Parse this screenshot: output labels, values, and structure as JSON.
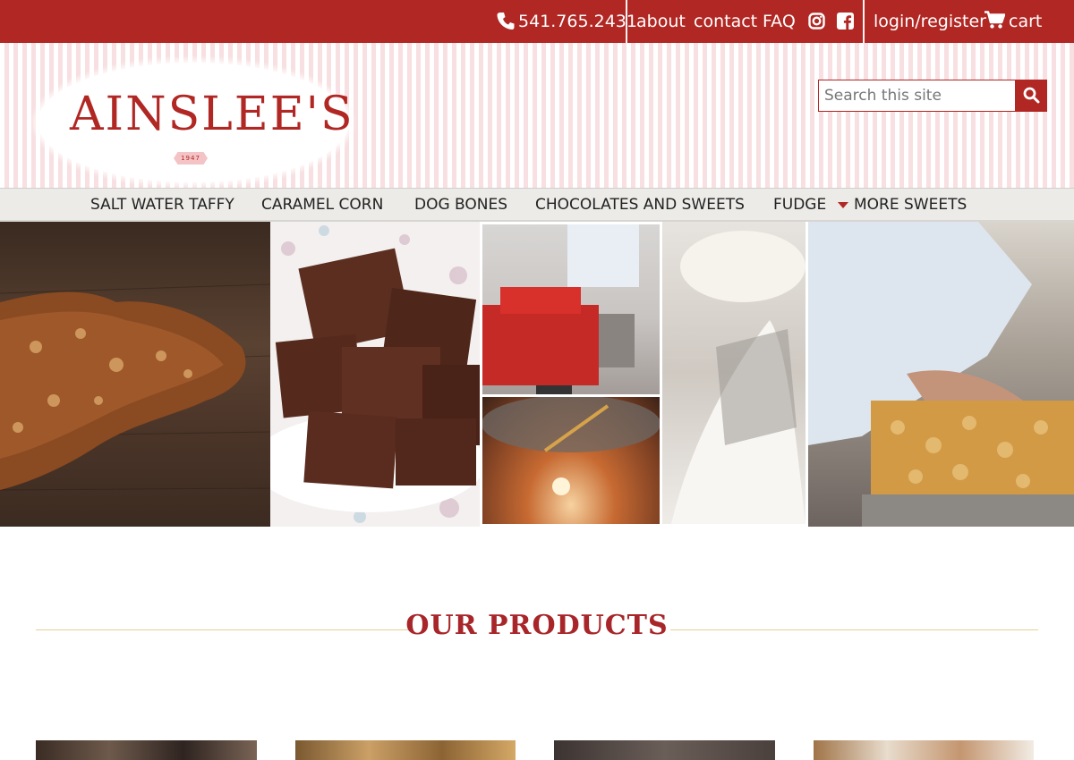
{
  "topbar": {
    "phone": "541.765.2431",
    "links": [
      "about",
      "contact",
      "FAQ"
    ],
    "login": "login/register",
    "cart": "cart",
    "icons": [
      "phone-icon",
      "instagram-icon",
      "facebook-icon",
      "cart-icon"
    ]
  },
  "header": {
    "logo_text": "AINSLEE'S",
    "logo_year": "1947",
    "search_placeholder": "Search this site"
  },
  "nav": {
    "items": [
      "SALT WATER TAFFY",
      "CARAMEL CORN",
      "DOG BONES",
      "CHOCOLATES AND SWEETS",
      "FUDGE",
      "MORE SWEETS"
    ]
  },
  "products": {
    "heading": "OUR PRODUCTS"
  },
  "colors": {
    "brand_red": "#b02723",
    "stripe_pink": "#f8dfe1",
    "nav_gray": "#ecebe8",
    "rule_gold": "#e8cf93"
  }
}
